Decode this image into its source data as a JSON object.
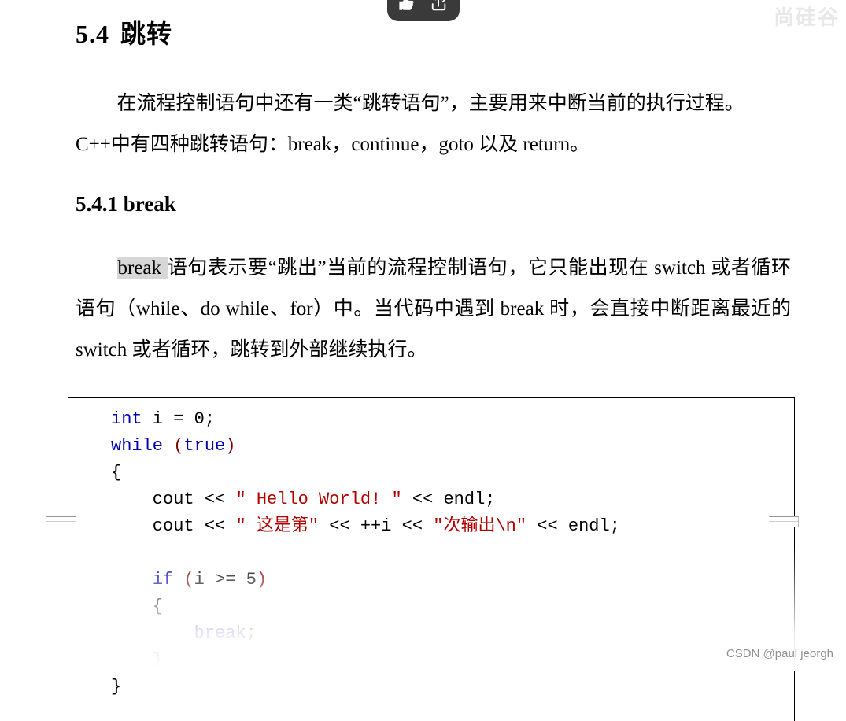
{
  "watermarks": {
    "top_right": "尚硅谷",
    "bottom_right_prefix": "CSDN ",
    "bottom_right_handle": "@paul jeorgh"
  },
  "section": {
    "number": "5.4",
    "title": "跳转",
    "intro_a": "在流程控制语句中还有一类“跳转语句”，主要用来中断当前的执行过程。",
    "intro_b": "C++中有四种跳转语句：break，continue，goto 以及 return。"
  },
  "subsection": {
    "number": "5.4.1",
    "title": "break",
    "body_hl": "break ",
    "body_rest_1": "语句表示要“跳出”当前的流程控制语句，它只能出现在 switch 或者循环语句（while、do while、for）中。当代码中遇到 break 时，会直接中断距离最近的 switch 或者循环，跳转到外部继续执行。"
  },
  "code": {
    "l1_kw": "int",
    "l1_rest": " i = 0;",
    "l2_kw": "while",
    "l2_par_o": " (",
    "l2_true": "true",
    "l2_par_c": ")",
    "l3": "{",
    "l4_a": "    cout << ",
    "l4_s": "\" Hello World! \"",
    "l4_b": " << endl;",
    "l5_a": "    cout << ",
    "l5_s1": "\" 这是第\"",
    "l5_b": " << ++i << ",
    "l5_s2": "\"次输出\\n\"",
    "l5_c": " << endl;",
    "l6": "",
    "l7_a": "    ",
    "l7_kw": "if",
    "l7_par_o": " (",
    "l7_cond": "i >= 5",
    "l7_par_c": ")",
    "l8": "    {",
    "l9_a": "        ",
    "l9_kw": "break",
    "l9_b": ";",
    "l10": "    }",
    "l11": "}"
  }
}
